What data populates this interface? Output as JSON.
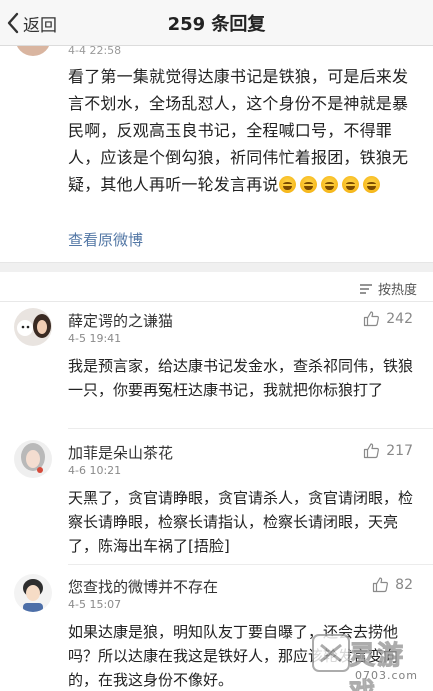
{
  "nav": {
    "back_label": "返回",
    "title": "259 条回复"
  },
  "post": {
    "time": "4-4 22:58",
    "text": "看了第一集就觉得达康书记是铁狼，可是后来发言不划水，全场乱怼人，这个身份不是神就是暴民啊，反观高玉良书记，全程喊口号，不得罪人，应该是个倒勾狼，祈同伟忙着报团，铁狼无疑，其他人再听一轮发言再说",
    "emoji": "laugh-cry-emoji",
    "emoji_count": 5,
    "view_original": "查看原微博"
  },
  "sort": {
    "label": "按热度",
    "icon": "sort-icon"
  },
  "comments": [
    {
      "name": "薛定谔的之谦猫",
      "time": "4-5 19:41",
      "likes": "242",
      "text": "我是预言家，给达康书记发金水，查杀祁同伟，铁狼一只，你要再冤枉达康书记，我就把你标狼打了"
    },
    {
      "name": "加菲是朵山茶花",
      "time": "4-6 10:21",
      "likes": "217",
      "text": "天黑了，贪官请睁眼，贪官请杀人，贪官请闭眼，检察长请睁眼，检察长请指认，检察长请闭眼，天亮了，陈海出车祸了[捂脸]"
    },
    {
      "name": "您查找的微博并不存在",
      "time": "4-5 15:07",
      "likes": "82",
      "text": "如果达康是狼，明知队友丁要自曝了，还会去捞他吗？所以达康在我这是铁好人，那应该轮发言变向的，在我这身份不像好。"
    }
  ],
  "colors": {
    "link": "#5478a6",
    "nav_bg": "#f7f7f7",
    "text": "#222222",
    "meta": "#8a8a8a"
  },
  "watermark": {
    "text": "灵游戏",
    "url": "0703.com"
  }
}
